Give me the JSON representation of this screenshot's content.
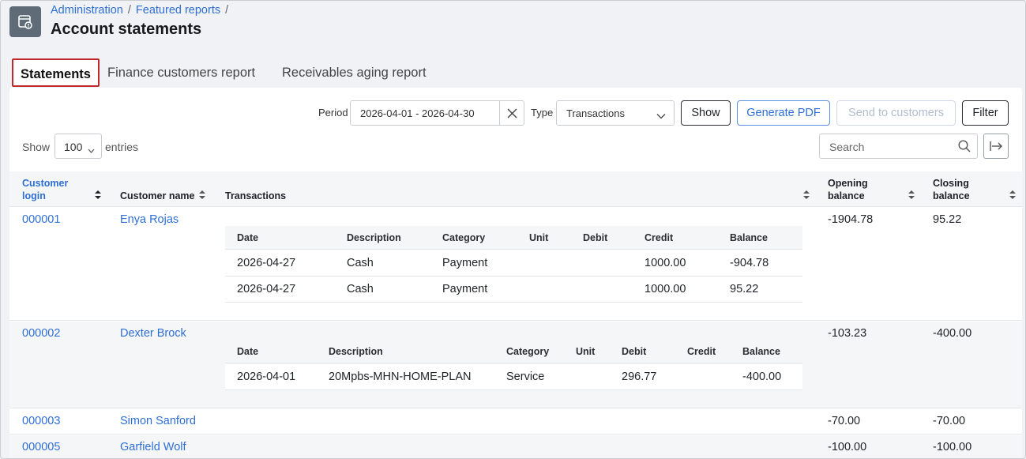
{
  "breadcrumb": {
    "item1": "Administration",
    "item2": "Featured reports",
    "sep": "/"
  },
  "page_title": "Account statements",
  "tabs": [
    "Statements",
    "Finance customers report",
    "Receivables aging report"
  ],
  "filters": {
    "period_label": "Period",
    "period_value": "2026-04-01 - 2026-04-30",
    "type_label": "Type",
    "type_value": "Transactions",
    "show_button": "Show",
    "generate_pdf_button": "Generate PDF",
    "send_button": "Send to customers",
    "filter_button": "Filter"
  },
  "entries": {
    "show_label": "Show",
    "value": "100",
    "entries_label": "entries"
  },
  "search": {
    "placeholder": "Search"
  },
  "table": {
    "headers": {
      "login_line1": "Customer",
      "login_line2": "login",
      "name": "Customer name",
      "transactions": "Transactions",
      "opening_line1": "Opening",
      "opening_line2": "balance",
      "closing_line1": "Closing",
      "closing_line2": "balance"
    },
    "sub_headers": [
      "Date",
      "Description",
      "Category",
      "Unit",
      "Debit",
      "Credit",
      "Balance"
    ],
    "rows": [
      {
        "login": "000001",
        "name": "Enya Rojas",
        "opening": "-1904.78",
        "closing": "95.22",
        "transactions": [
          {
            "date": "2026-04-27",
            "description": "Cash",
            "category": "Payment",
            "unit": "",
            "debit": "",
            "credit": "1000.00",
            "balance": "-904.78"
          },
          {
            "date": "2026-04-27",
            "description": "Cash",
            "category": "Payment",
            "unit": "",
            "debit": "",
            "credit": "1000.00",
            "balance": "95.22"
          }
        ]
      },
      {
        "login": "000002",
        "name": "Dexter Brock",
        "opening": "-103.23",
        "closing": "-400.00",
        "transactions": [
          {
            "date": "2026-04-01",
            "description": "20Mpbs-MHN-HOME-PLAN",
            "category": "Service",
            "unit": "",
            "debit": "296.77",
            "credit": "",
            "balance": "-400.00"
          }
        ]
      },
      {
        "login": "000003",
        "name": "Simon Sanford",
        "opening": "-70.00",
        "closing": "-70.00",
        "transactions": []
      },
      {
        "login": "000005",
        "name": "Garfield Wolf",
        "opening": "-100.00",
        "closing": "-100.00",
        "transactions": []
      }
    ]
  }
}
